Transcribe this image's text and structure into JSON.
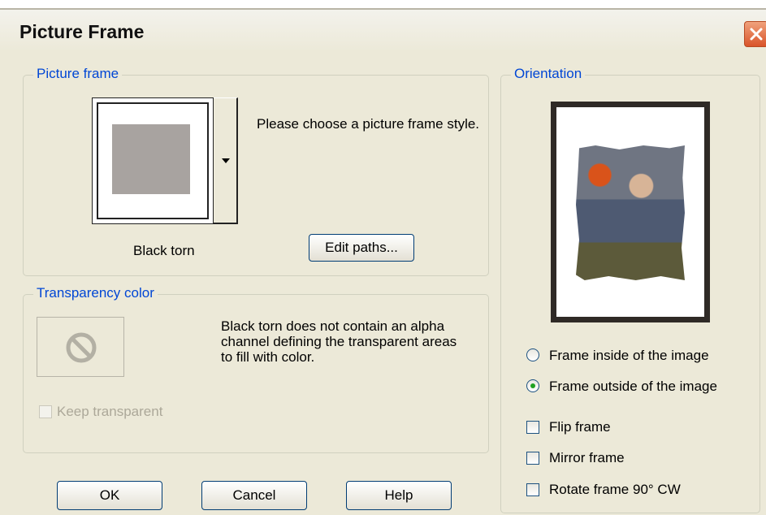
{
  "window": {
    "title": "Picture Frame"
  },
  "picture_frame_group": {
    "label": "Picture frame",
    "selected_frame_name": "Black torn",
    "instruction": "Please choose a picture frame style.",
    "edit_paths_label": "Edit paths..."
  },
  "transparency_group": {
    "label": "Transparency color",
    "message": "Black torn does not contain an alpha channel defining the transparent areas to fill with color.",
    "keep_transparent_label": "Keep transparent",
    "keep_transparent_checked": false,
    "keep_transparent_enabled": false
  },
  "orientation_group": {
    "label": "Orientation",
    "radio_inside_label": "Frame inside of the image",
    "radio_outside_label": "Frame outside of the image",
    "selected": "outside",
    "flip_label": "Flip frame",
    "mirror_label": "Mirror frame",
    "rotate_label": "Rotate frame 90° CW"
  },
  "buttons": {
    "ok": "OK",
    "cancel": "Cancel",
    "help": "Help"
  },
  "colors": {
    "dialog_bg": "#ece9d8",
    "group_label": "#0046d5",
    "close_button": "#d9542a"
  },
  "icons": [
    "close-icon",
    "dropdown-arrow-icon",
    "no-symbol-icon"
  ]
}
